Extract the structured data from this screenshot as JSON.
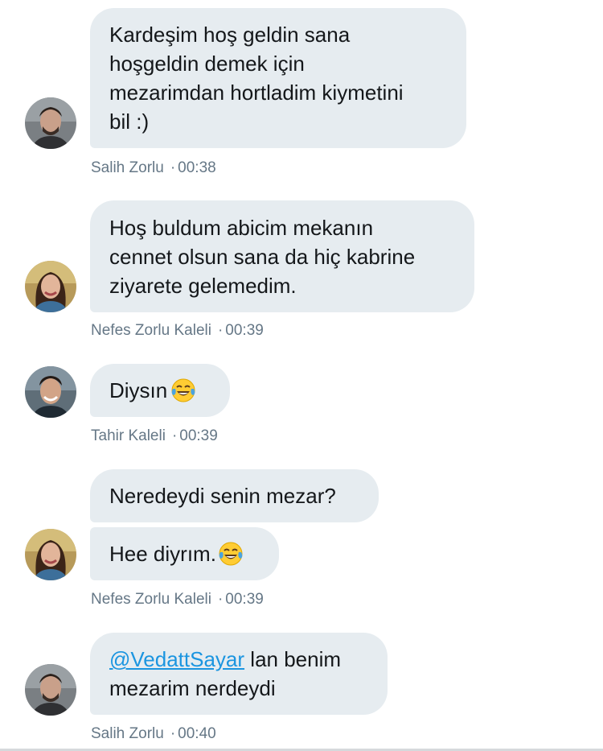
{
  "messages": [
    {
      "text": "Kardeşim hoş geldin sana\nhoşgeldin demek için\nmezarimdan hortladim kiymetini\nbil :)",
      "sender": "Salih Zorlu",
      "time": "00:38",
      "avatar": "salih-avatar"
    },
    {
      "text": "Hoş buldum abicim mekanın\ncennet olsun sana da hiç kabrine\nziyarete gelemedim.",
      "sender": "Nefes Zorlu Kaleli",
      "time": "00:39",
      "avatar": "nefes-avatar"
    },
    {
      "text": "Diysın",
      "emoji": "face-with-tears-of-joy",
      "sender": "Tahir Kaleli",
      "time": "00:39",
      "avatar": "tahir-avatar"
    },
    {
      "text": "Neredeydi senin mezar?",
      "sender": "Nefes Zorlu Kaleli"
    },
    {
      "text": "Hee diyrım.",
      "emoji": "face-with-tears-of-joy",
      "sender": "Nefes Zorlu Kaleli",
      "time": "00:39",
      "avatar": "nefes-avatar"
    },
    {
      "mention": "@VedattSayar",
      "text": " lan benim\nmezarim nerdeydi",
      "sender": "Salih Zorlu",
      "time": "00:40",
      "avatar": "salih-avatar"
    }
  ],
  "meta_separator": "·",
  "colors": {
    "bubble_bg": "#e6ecf0",
    "text": "#14171a",
    "meta": "#657786",
    "link": "#1b95e0"
  }
}
